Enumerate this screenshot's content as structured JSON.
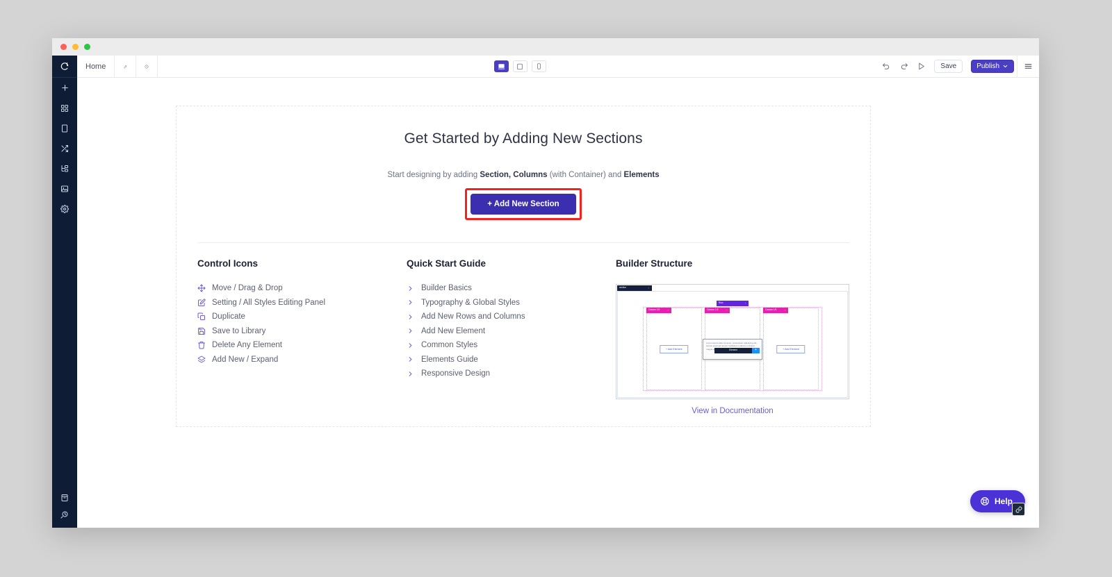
{
  "window": {
    "traffic_lights": [
      "close",
      "minimize",
      "maximize"
    ]
  },
  "topbar": {
    "tab_label": "Home",
    "icons": [
      "wrench-icon",
      "clock-icon"
    ],
    "devices": [
      {
        "name": "desktop",
        "active": true
      },
      {
        "name": "tablet",
        "active": false
      },
      {
        "name": "mobile",
        "active": false
      }
    ],
    "undo": "undo-icon",
    "redo": "redo-icon",
    "preview": "preview-play-icon",
    "save_label": "Save",
    "publish_label": "Publish",
    "menu": "hamburger-menu-icon"
  },
  "sidebar": {
    "logo": "brand-logo",
    "items": [
      {
        "name": "add",
        "icon": "plus-icon"
      },
      {
        "name": "layouts",
        "icon": "grid-icon"
      },
      {
        "name": "pages",
        "icon": "page-icon"
      },
      {
        "name": "shuffle",
        "icon": "shuffle-icon"
      },
      {
        "name": "structure",
        "icon": "tree-structure-icon"
      },
      {
        "name": "media",
        "icon": "image-icon"
      },
      {
        "name": "settings",
        "icon": "gear-icon"
      }
    ],
    "bottom_items": [
      {
        "name": "library",
        "icon": "book-icon"
      },
      {
        "name": "revisions",
        "icon": "revision-history-icon"
      }
    ]
  },
  "hero": {
    "title": "Get Started by Adding New Sections",
    "subtitle_pre": "Start designing by adding ",
    "subtitle_bold1": "Section, Columns",
    "subtitle_mid": " (with Container) and ",
    "subtitle_bold2": "Elements",
    "add_button_label": "+ Add New Section",
    "highlight_color": "#f4221f"
  },
  "control_icons": {
    "heading": "Control Icons",
    "items": [
      {
        "label": "Move / Drag & Drop",
        "icon": "move-arrows-icon"
      },
      {
        "label": "Setting / All Styles Editing Panel",
        "icon": "edit-pencil-square-icon"
      },
      {
        "label": "Duplicate",
        "icon": "duplicate-copy-icon"
      },
      {
        "label": "Save to Library",
        "icon": "save-floppy-icon"
      },
      {
        "label": "Delete Any Element",
        "icon": "trash-icon"
      },
      {
        "label": "Add New / Expand",
        "icon": "layers-stack-icon"
      }
    ]
  },
  "quick_start": {
    "heading": "Quick Start Guide",
    "items": [
      {
        "label": "Builder Basics",
        "icon": "chevron-right-icon"
      },
      {
        "label": "Typography & Global Styles",
        "icon": "chevron-right-icon"
      },
      {
        "label": "Add New Rows and Columns",
        "icon": "chevron-right-icon"
      },
      {
        "label": "Add New Element",
        "icon": "chevron-right-icon"
      },
      {
        "label": "Common Styles",
        "icon": "chevron-right-icon"
      },
      {
        "label": "Elements Guide",
        "icon": "chevron-right-icon"
      },
      {
        "label": "Responsive Design",
        "icon": "chevron-right-icon"
      }
    ]
  },
  "builder_structure": {
    "heading": "Builder Structure",
    "doc_link_label": "View in Documentation",
    "diagram": {
      "section_label": "section",
      "row_label": "Row",
      "column_labels": [
        "Column 1/3",
        "Column 1/3",
        "Column 1/3"
      ],
      "add_element_label": "+ Add Element",
      "element_tooltip_label": "Element",
      "element_plus_label": "+",
      "lorem_text": "Lorem ipsum dolor sit amet, consectetur adipiscing elit, sed do eiusmod tempor incididunt ut labore et dolore magna aliqua. Ut enim ad minim veniam.",
      "colors": {
        "section": "#15213c",
        "row": "#6324e0",
        "column": "#ea1cb2",
        "element": "#15213c",
        "element_plus": "#1f8ff5"
      }
    }
  },
  "help": {
    "label": "Help",
    "icon": "lifebuoy-icon",
    "badge_icon": "link-chain-icon",
    "color": "#4a32d6"
  }
}
